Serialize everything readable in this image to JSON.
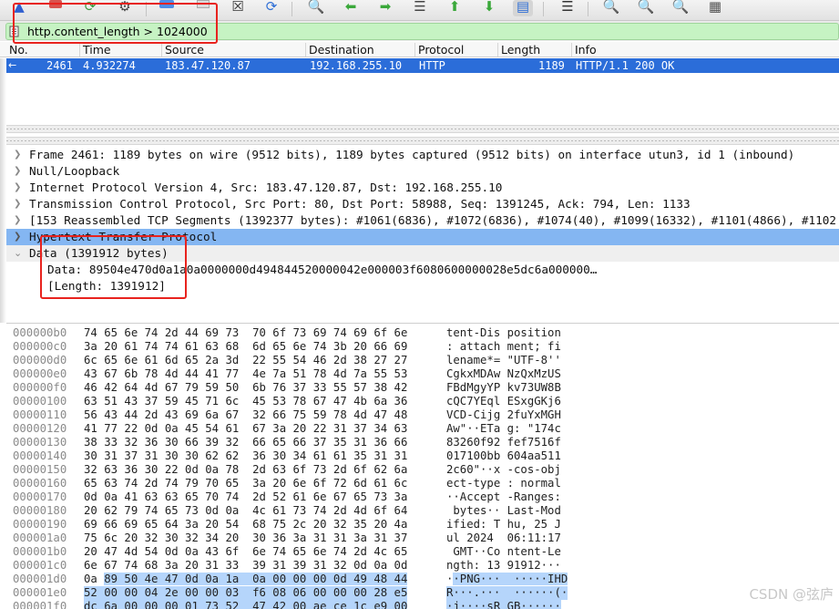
{
  "toolbar": {
    "icons": [
      "fin-icon",
      "stop-capture-icon",
      "restart-capture-icon",
      "capture-options-icon",
      "open-file-icon",
      "save-file-icon",
      "close-file-icon",
      "reload-file-icon",
      "find-packet-icon",
      "go-back-icon",
      "go-forward-icon",
      "go-to-packet-icon",
      "go-first-packet-icon",
      "go-last-packet-icon",
      "auto-scroll-icon",
      "colorize-icon",
      "zoom-in-icon",
      "zoom-out-icon",
      "zoom-normal-icon",
      "resize-columns-icon"
    ]
  },
  "filter": {
    "value": "http.content_length > 1024000"
  },
  "packet_list": {
    "columns": [
      "No.",
      "Time",
      "Source",
      "Destination",
      "Protocol",
      "Length",
      "Info"
    ],
    "rows": [
      {
        "no": "2461",
        "time": "4.932274",
        "source": "183.47.120.87",
        "destination": "192.168.255.10",
        "protocol": "HTTP",
        "length": "1189",
        "info": "HTTP/1.1 200 OK"
      }
    ]
  },
  "details": [
    "Frame 2461: 1189 bytes on wire (9512 bits), 1189 bytes captured (9512 bits) on interface utun3, id 1 (inbound)",
    "Null/Loopback",
    "Internet Protocol Version 4, Src: 183.47.120.87, Dst: 192.168.255.10",
    "Transmission Control Protocol, Src Port: 80, Dst Port: 58988, Seq: 1391245, Ack: 794, Len: 1133",
    "[153 Reassembled TCP Segments (1392377 bytes): #1061(6836), #1072(6836), #1074(40), #1099(16332), #1101(4866), #1102",
    "Hypertext Transfer Protocol",
    "Data (1391912 bytes)",
    "Data: 89504e470d0a1a0a0000000d494844520000042e000003f6080600000028e5dc6a000000…",
    "[Length: 1391912]"
  ],
  "hex_rows": [
    {
      "off": "000000b0",
      "bytes": "74 65 6e 74 2d 44 69 73  70 6f 73 69 74 69 6f 6e",
      "ascii": "tent-Dis position"
    },
    {
      "off": "000000c0",
      "bytes": "3a 20 61 74 74 61 63 68  6d 65 6e 74 3b 20 66 69",
      "ascii": ": attach ment; fi"
    },
    {
      "off": "000000d0",
      "bytes": "6c 65 6e 61 6d 65 2a 3d  22 55 54 46 2d 38 27 27",
      "ascii": "lename*= \"UTF-8''"
    },
    {
      "off": "000000e0",
      "bytes": "43 67 6b 78 4d 44 41 77  4e 7a 51 78 4d 7a 55 53",
      "ascii": "CgkxMDAw NzQxMzUS"
    },
    {
      "off": "000000f0",
      "bytes": "46 42 64 4d 67 79 59 50  6b 76 37 33 55 57 38 42",
      "ascii": "FBdMgyYP kv73UW8B"
    },
    {
      "off": "00000100",
      "bytes": "63 51 43 37 59 45 71 6c  45 53 78 67 47 4b 6a 36",
      "ascii": "cQC7YEql ESxgGKj6"
    },
    {
      "off": "00000110",
      "bytes": "56 43 44 2d 43 69 6a 67  32 66 75 59 78 4d 47 48",
      "ascii": "VCD-Cijg 2fuYxMGH"
    },
    {
      "off": "00000120",
      "bytes": "41 77 22 0d 0a 45 54 61  67 3a 20 22 31 37 34 63",
      "ascii": "Aw\"··ETa g: \"174c"
    },
    {
      "off": "00000130",
      "bytes": "38 33 32 36 30 66 39 32  66 65 66 37 35 31 36 66",
      "ascii": "83260f92 fef7516f"
    },
    {
      "off": "00000140",
      "bytes": "30 31 37 31 30 30 62 62  36 30 34 61 61 35 31 31",
      "ascii": "017100bb 604aa511"
    },
    {
      "off": "00000150",
      "bytes": "32 63 36 30 22 0d 0a 78  2d 63 6f 73 2d 6f 62 6a",
      "ascii": "2c60\"··x -cos-obj"
    },
    {
      "off": "00000160",
      "bytes": "65 63 74 2d 74 79 70 65  3a 20 6e 6f 72 6d 61 6c",
      "ascii": "ect-type : normal"
    },
    {
      "off": "00000170",
      "bytes": "0d 0a 41 63 63 65 70 74  2d 52 61 6e 67 65 73 3a",
      "ascii": "··Accept -Ranges:"
    },
    {
      "off": "00000180",
      "bytes": "20 62 79 74 65 73 0d 0a  4c 61 73 74 2d 4d 6f 64",
      "ascii": " bytes·· Last-Mod"
    },
    {
      "off": "00000190",
      "bytes": "69 66 69 65 64 3a 20 54  68 75 2c 20 32 35 20 4a",
      "ascii": "ified: T hu, 25 J"
    },
    {
      "off": "000001a0",
      "bytes": "75 6c 20 32 30 32 34 20  30 36 3a 31 31 3a 31 37",
      "ascii": "ul 2024  06:11:17"
    },
    {
      "off": "000001b0",
      "bytes": "20 47 4d 54 0d 0a 43 6f  6e 74 65 6e 74 2d 4c 65",
      "ascii": " GMT··Co ntent-Le"
    },
    {
      "off": "000001c0",
      "bytes": "6e 67 74 68 3a 20 31 33  39 31 39 31 32 0d 0a 0d",
      "ascii": "ngth: 13 91912···"
    },
    {
      "off": "000001d0",
      "bytes_plain": "0a ",
      "bytes_hl": "89 50 4e 47 0d 0a 1a  0a 00 00 00 0d 49 48 44",
      "ascii_plain": "·",
      "ascii_hl": "·PNG···  ·····IHD"
    },
    {
      "off": "000001e0",
      "bytes_hl": "52 00 00 04 2e 00 00 03  f6 08 06 00 00 00 28 e5",
      "ascii_hl": "R···.···  ······(·"
    },
    {
      "off": "000001f0",
      "bytes_hl": "dc 6a 00 00 00 01 73 52  47 42 00 ae ce 1c e9 00",
      "ascii_hl": "·j····sR GB······"
    }
  ],
  "watermark": "CSDN @弦庐"
}
